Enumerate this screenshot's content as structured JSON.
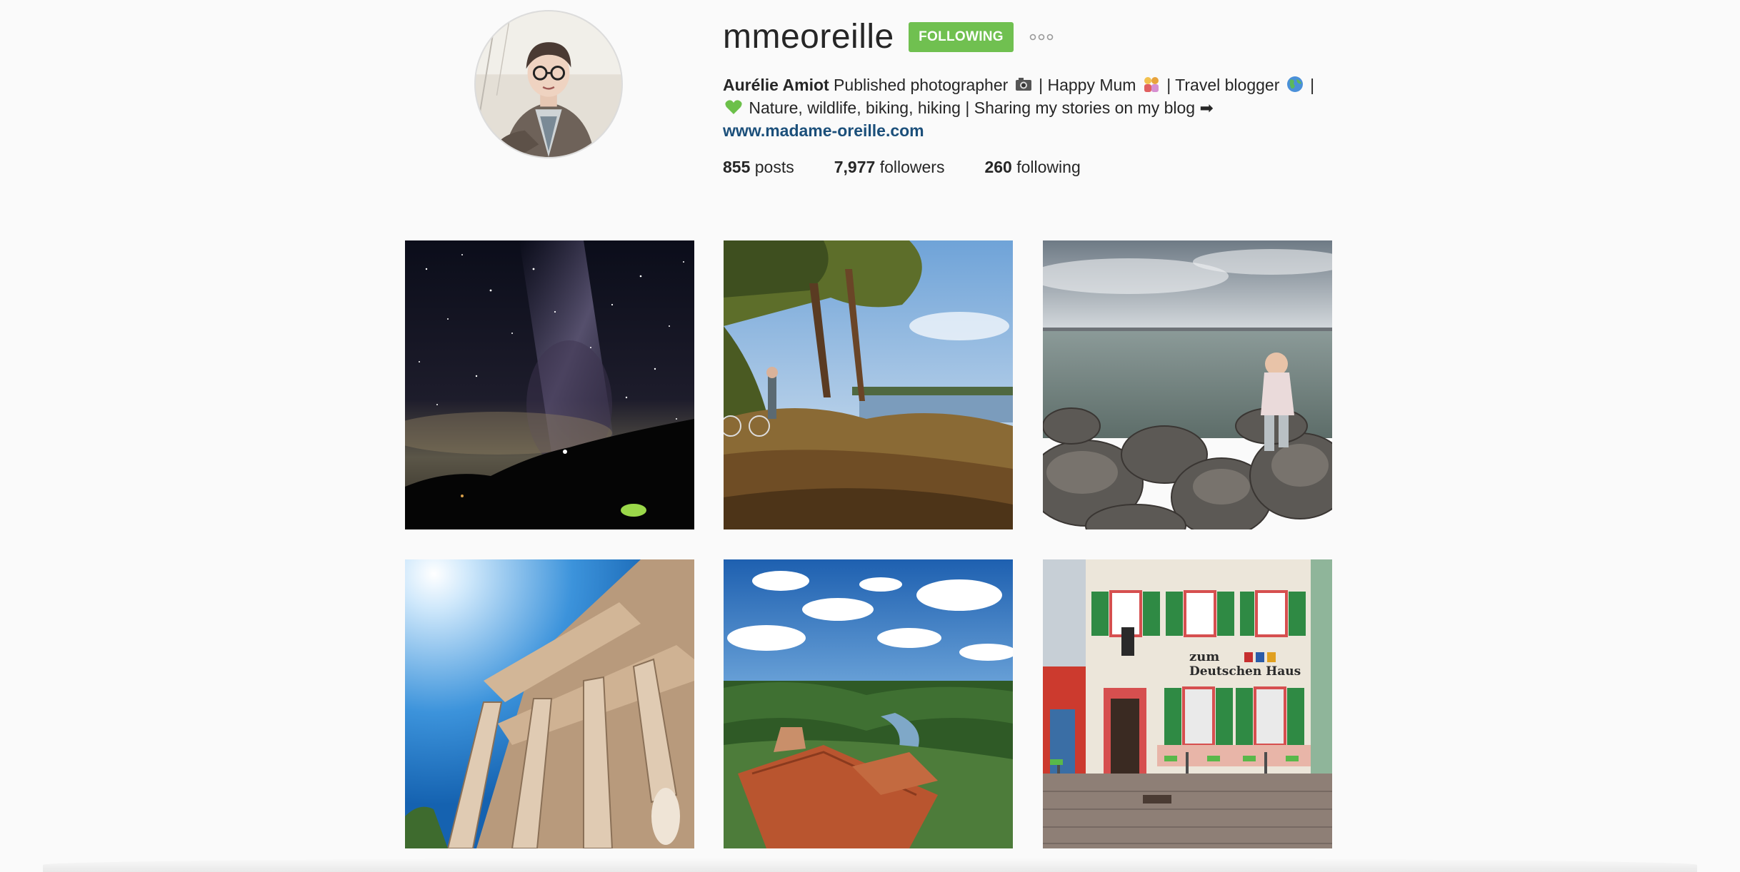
{
  "profile": {
    "username": "mmeoreille",
    "follow_button_label": "FOLLOWING",
    "more_options_icon": "ellipsis-icon",
    "avatar_icon": "profile-avatar",
    "bio": {
      "full_name": "Aurélie Amiot",
      "line1_text": " Published photographer",
      "line1_sep1": " | Happy Mum",
      "line1_sep2": " | Travel blogger",
      "line1_sep3": " |",
      "line2_text": " Nature, wildlife, biking, hiking | Sharing my stories on my blog ➡"
    },
    "website": "www.madame-oreille.com",
    "stats": {
      "posts_count": "855",
      "posts_label": "posts",
      "followers_count": "7,977",
      "followers_label": "followers",
      "following_count": "260",
      "following_label": "following"
    }
  },
  "colors": {
    "background": "#fafafa",
    "follow_button": "#70c050",
    "link": "#1b4f7a",
    "text": "#262626"
  },
  "posts": [
    {
      "thumbnail": "milky-way-night-sky-photo"
    },
    {
      "thumbnail": "forest-lake-bicycle-photo"
    },
    {
      "thumbnail": "child-on-rocks-lake-photo"
    },
    {
      "thumbnail": "ancient-library-columns-photo"
    },
    {
      "thumbnail": "river-valley-rooftop-photo"
    },
    {
      "thumbnail": "zum-deutschen-haus-facade-photo"
    }
  ],
  "signage": {
    "shop_sign_line1": "zum",
    "shop_sign_line2": "Deutschen Haus"
  }
}
